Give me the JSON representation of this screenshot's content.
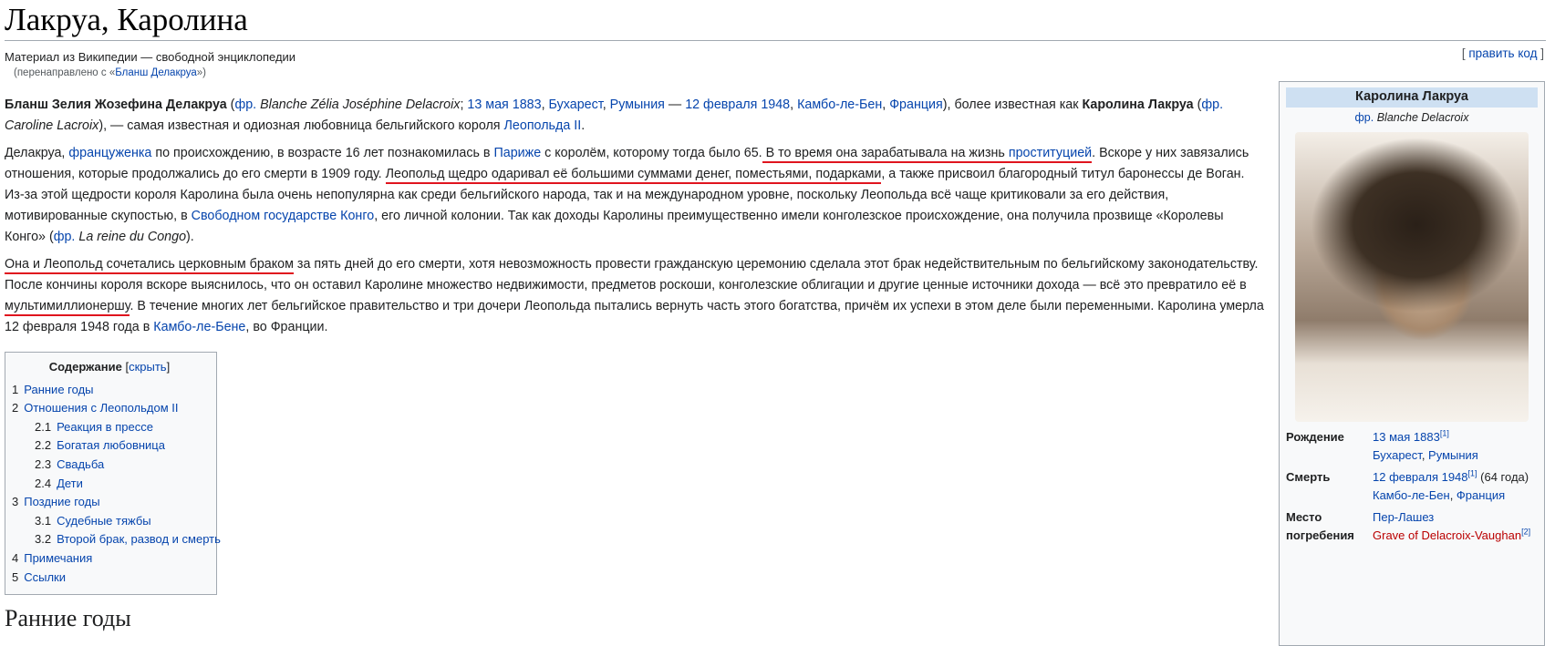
{
  "page": {
    "title": "Лакруа, Каролина",
    "site_sub": "Материал из Википедии — свободной энциклопедии",
    "redirect_prefix": "(перенаправлено с «",
    "redirect_link": "Бланш Делакруа",
    "redirect_suffix": "»)",
    "edit_open": "[ ",
    "edit_label": "править код",
    "edit_close": " ]"
  },
  "p1": {
    "t0": "Бланш Зелия Жозефина Делакруа",
    "t1": " (",
    "l_fr": "фр.",
    "t2": " ",
    "i1": "Blanche Zélia Joséphine Delacroix",
    "t3": "; ",
    "l_birth": "13 мая 1883",
    "t4": ", ",
    "l_buch": "Бухарест",
    "t5": ", ",
    "l_rom": "Румыния",
    "t6": " — ",
    "l_death": "12 февраля 1948",
    "t7": ", ",
    "l_cambo": "Камбо-ле-Бен",
    "t8": ", ",
    "l_fra": "Франция",
    "t9": "), более известная как ",
    "b2": "Каролина Лакруа",
    "t10": " (",
    "l_fr2": "фр.",
    "t11": " ",
    "i2": "Caroline Lacroix",
    "t12": "), — самая известная и одиозная любовница бельгийского короля ",
    "l_leo": "Леопольда II",
    "t13": "."
  },
  "p2": {
    "t0": "Делакруа, ",
    "l_fr": "француженка",
    "t1": " по происхождению, в возрасте 16 лет познакомилась в ",
    "l_paris": "Париже",
    "t2": " с королём, которому тогда было 65.",
    "u1": " В то время она зарабатывала на жизнь ",
    "l_prost": "проституцией",
    "t3": ". Вскоре у них завязались отношения, которые продолжались до его смерти в 1909 году. ",
    "u2": "Леопольд щедро одаривал её большими суммами денег, поместьями, подарками",
    "t4": ", а также присвоил благородный титул баронессы де Воган. Из-за этой щедрости короля Каролина была очень непопулярна как среди бельгийского народа, так и на международном уровне, поскольку Леопольда всё чаще критиковали за его действия, мотивированные скупостью, в ",
    "l_congo": "Свободном государстве Конго",
    "t5": ", его личной колонии. Так как доходы Каролины преимущественно имели конголезское происхождение, она получила прозвище «Королевы Конго» (",
    "l_fr2": "фр.",
    "t6": " ",
    "i1": "La reine du Congo",
    "t7": ")."
  },
  "p3": {
    "u1": "Она и Леопольд сочетались церковным браком",
    "t1": " за пять дней до его смерти, хотя невозможность провести гражданскую церемонию сделала этот брак недействительным по бельгийскому законодательству. После кончины короля вскоре выяснилось, что он оставил Каролине множество недвижимости, предметов роскоши, конголезские облигации и другие ценные источники дохода — всё это превратило её в ",
    "u2": "мультимиллионершу",
    "t2": ". В течение многих лет бельгийское правительство и три дочери Леопольда пытались вернуть часть этого богатства, причём их успехи в этом деле были переменными. Каролина умерла 12 февраля 1948 года в ",
    "l_cambo": "Камбо-ле-Бене",
    "t3": ", во Франции."
  },
  "toc": {
    "title": "Содержание",
    "toggle_open": " [",
    "toggle": "скрыть",
    "toggle_close": "]",
    "items": [
      {
        "num": "1",
        "label": "Ранние годы",
        "level": 1
      },
      {
        "num": "2",
        "label": "Отношения с Леопольдом II",
        "level": 1
      },
      {
        "num": "2.1",
        "label": "Реакция в прессе",
        "level": 2
      },
      {
        "num": "2.2",
        "label": "Богатая любовница",
        "level": 2
      },
      {
        "num": "2.3",
        "label": "Свадьба",
        "level": 2
      },
      {
        "num": "2.4",
        "label": "Дети",
        "level": 2
      },
      {
        "num": "3",
        "label": "Поздние годы",
        "level": 1
      },
      {
        "num": "3.1",
        "label": "Судебные тяжбы",
        "level": 2
      },
      {
        "num": "3.2",
        "label": "Второй брак, развод и смерть",
        "level": 2
      },
      {
        "num": "4",
        "label": "Примечания",
        "level": 1
      },
      {
        "num": "5",
        "label": "Ссылки",
        "level": 1
      }
    ]
  },
  "next_heading": "Ранние годы",
  "infobox": {
    "title": "Каролина Лакруа",
    "sub_fr": "фр.",
    "sub_name": "Blanche Delacroix",
    "birth_label": "Рождение",
    "birth_date": "13 мая 1883",
    "birth_ref": "[1]",
    "birth_city": "Бухарест",
    "birth_country": "Румыния",
    "death_label": "Смерть",
    "death_date": "12 февраля 1948",
    "death_ref": "[1]",
    "death_age": " (64 года)",
    "death_city": "Камбо-ле-Бен",
    "death_country": "Франция",
    "burial_label": "Место погребения",
    "burial_place": "Пер-Лашез",
    "burial_grave": "Grave of Delacroix-Vaughan",
    "burial_ref": "[2]"
  }
}
